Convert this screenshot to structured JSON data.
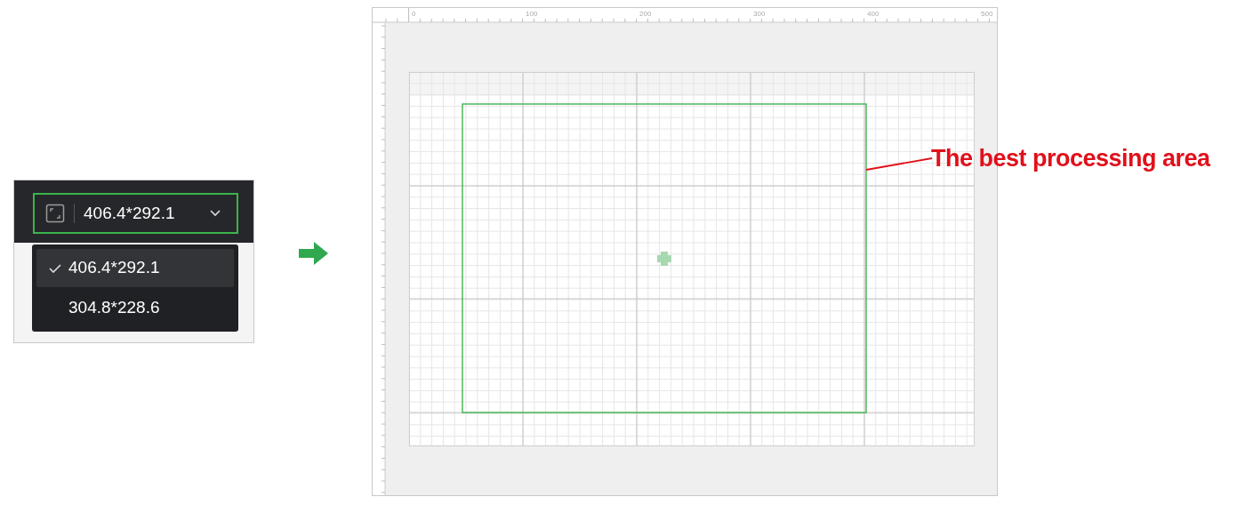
{
  "size_selector": {
    "value": "406.4*292.1",
    "options": [
      {
        "label": "406.4*292.1",
        "selected": true
      },
      {
        "label": "304.8*228.6",
        "selected": false
      }
    ]
  },
  "canvas": {
    "ruler_labels": [
      "0",
      "100",
      "200",
      "300",
      "400",
      "500"
    ]
  },
  "annotation": {
    "text": "The best processing area"
  }
}
